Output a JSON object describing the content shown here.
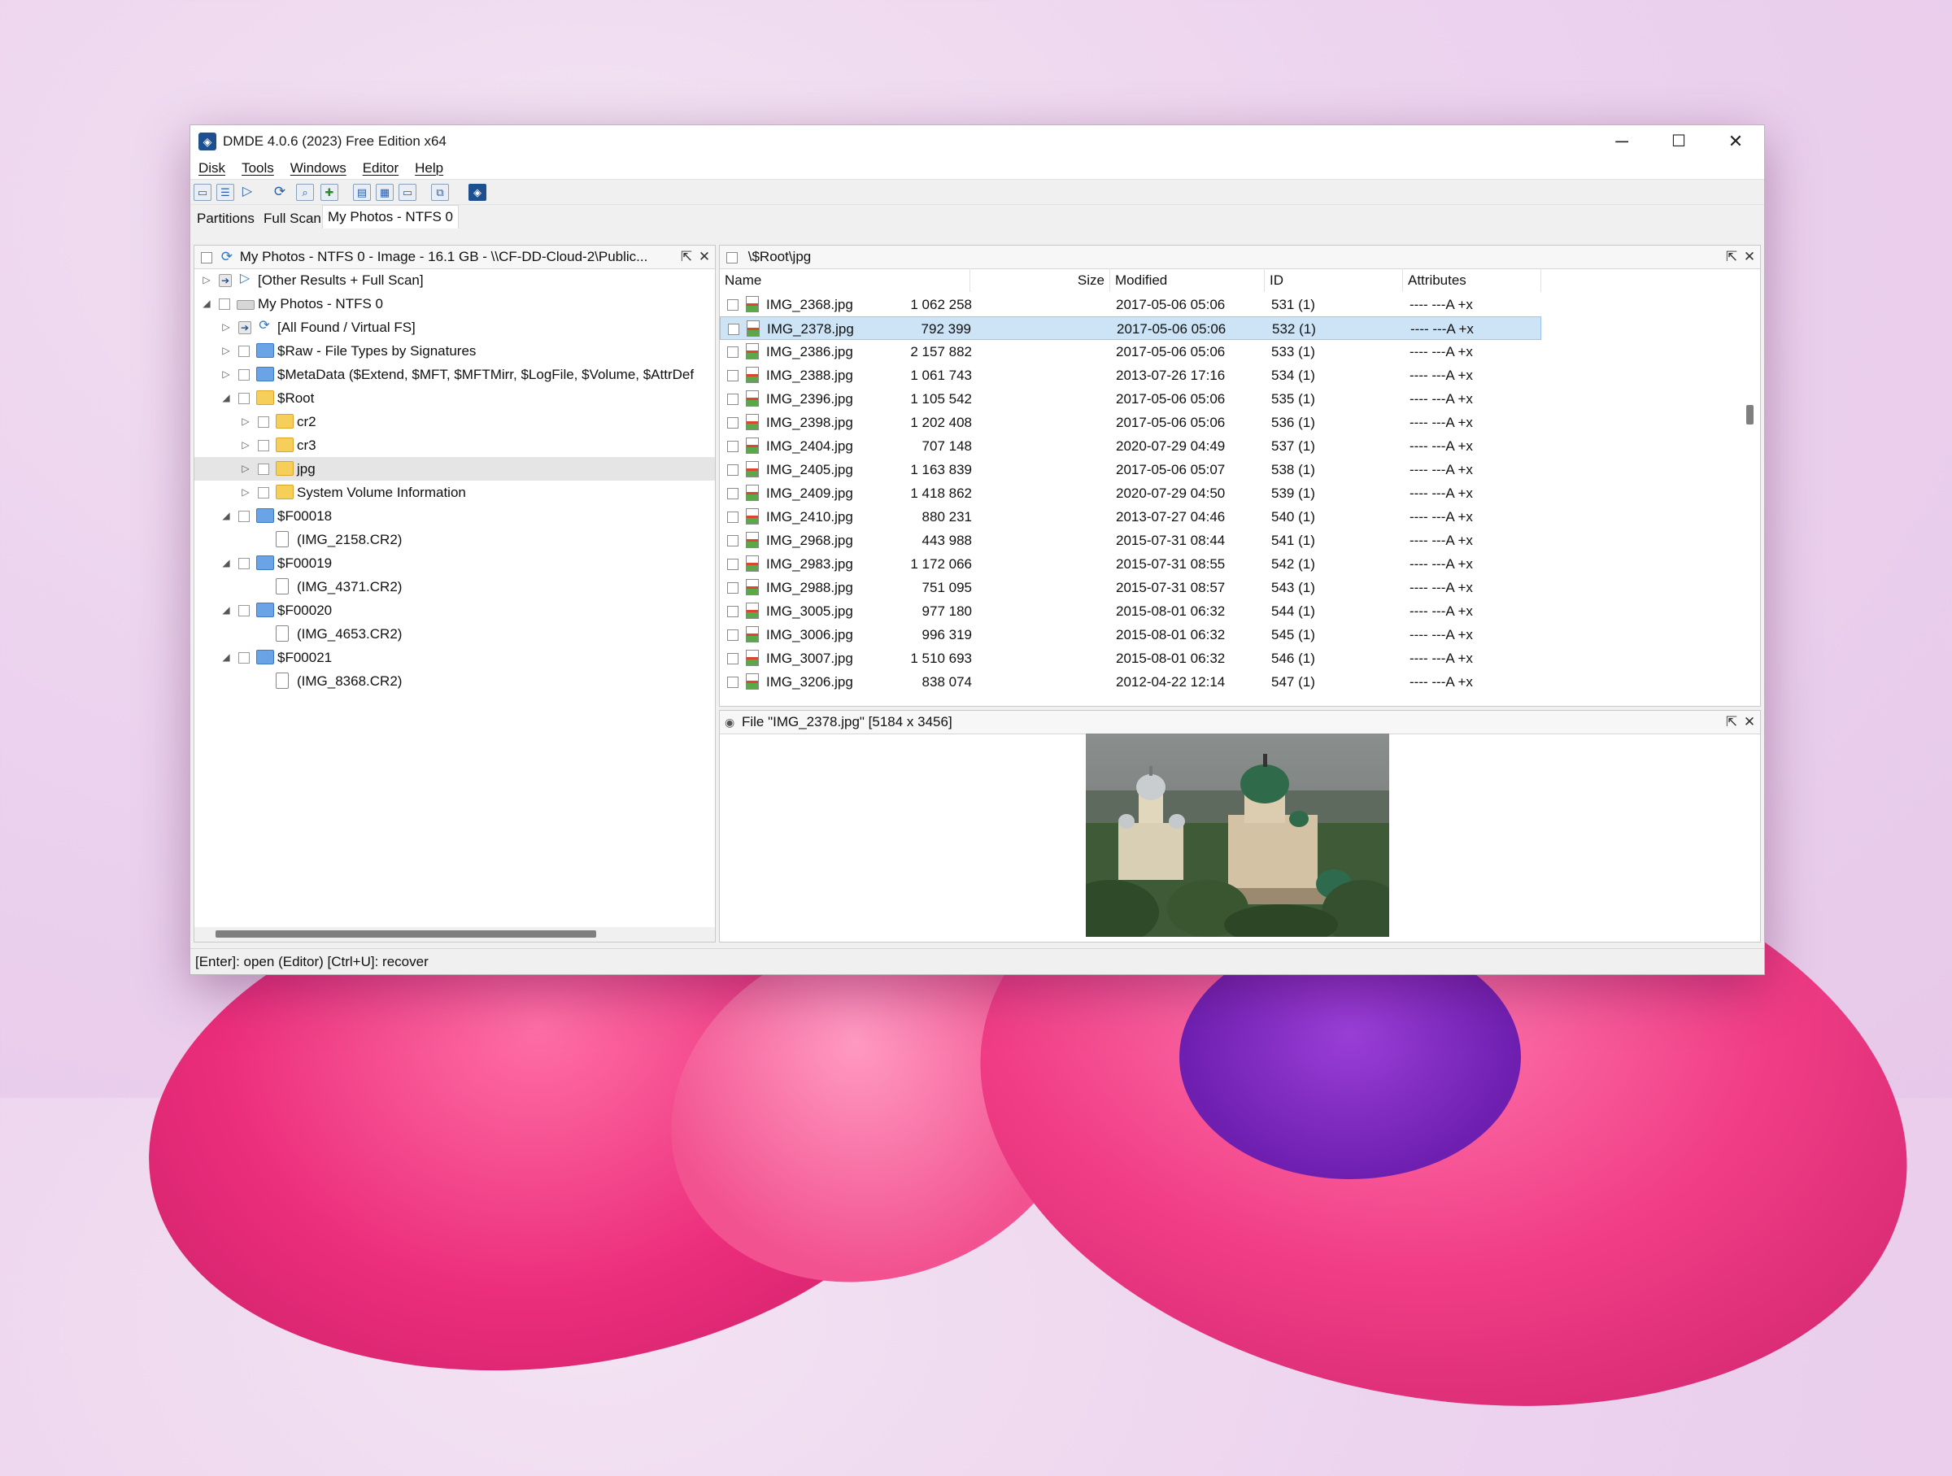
{
  "window": {
    "title": "DMDE 4.0.6 (2023) Free Edition x64",
    "controls": {
      "minimize": "─",
      "maximize": "☐",
      "close": "✕"
    }
  },
  "menu": [
    "Disk",
    "Tools",
    "Windows",
    "Editor",
    "Help"
  ],
  "tabs": [
    "Partitions",
    "Full Scan",
    "My Photos - NTFS 0"
  ],
  "tree_pane": {
    "header": "My Photos - NTFS 0 - Image - 16.1 GB - \\\\CF-DD-Cloud-2\\Public...",
    "items": [
      {
        "label": "[Other Results + Full Scan]"
      },
      {
        "label": "My Photos - NTFS 0"
      },
      {
        "label": "[All Found / Virtual FS]"
      },
      {
        "label": "$Raw - File Types by Signatures"
      },
      {
        "label": "$MetaData ($Extend, $MFT, $MFTMirr, $LogFile, $Volume, $AttrDef"
      },
      {
        "label": "$Root"
      },
      {
        "label": "cr2"
      },
      {
        "label": "cr3"
      },
      {
        "label": "jpg"
      },
      {
        "label": "System Volume Information"
      },
      {
        "label": "$F00018"
      },
      {
        "label": "(IMG_2158.CR2)"
      },
      {
        "label": "$F00019"
      },
      {
        "label": "(IMG_4371.CR2)"
      },
      {
        "label": "$F00020"
      },
      {
        "label": "(IMG_4653.CR2)"
      },
      {
        "label": "$F00021"
      },
      {
        "label": "(IMG_8368.CR2)"
      }
    ]
  },
  "file_pane": {
    "header": "\\$Root\\jpg",
    "columns": {
      "name": "Name",
      "size": "Size",
      "modified": "Modified",
      "id": "ID",
      "attributes": "Attributes"
    },
    "rows": [
      {
        "name": "IMG_2368.jpg",
        "size": "1 062 258",
        "modified": "2017-05-06 05:06",
        "id": "531 (1)",
        "attr": "---- ---A +x"
      },
      {
        "name": "IMG_2378.jpg",
        "size": "792 399",
        "modified": "2017-05-06 05:06",
        "id": "532 (1)",
        "attr": "---- ---A +x"
      },
      {
        "name": "IMG_2386.jpg",
        "size": "2 157 882",
        "modified": "2017-05-06 05:06",
        "id": "533 (1)",
        "attr": "---- ---A +x"
      },
      {
        "name": "IMG_2388.jpg",
        "size": "1 061 743",
        "modified": "2013-07-26 17:16",
        "id": "534 (1)",
        "attr": "---- ---A +x"
      },
      {
        "name": "IMG_2396.jpg",
        "size": "1 105 542",
        "modified": "2017-05-06 05:06",
        "id": "535 (1)",
        "attr": "---- ---A +x"
      },
      {
        "name": "IMG_2398.jpg",
        "size": "1 202 408",
        "modified": "2017-05-06 05:06",
        "id": "536 (1)",
        "attr": "---- ---A +x"
      },
      {
        "name": "IMG_2404.jpg",
        "size": "707 148",
        "modified": "2020-07-29 04:49",
        "id": "537 (1)",
        "attr": "---- ---A +x"
      },
      {
        "name": "IMG_2405.jpg",
        "size": "1 163 839",
        "modified": "2017-05-06 05:07",
        "id": "538 (1)",
        "attr": "---- ---A +x"
      },
      {
        "name": "IMG_2409.jpg",
        "size": "1 418 862",
        "modified": "2020-07-29 04:50",
        "id": "539 (1)",
        "attr": "---- ---A +x"
      },
      {
        "name": "IMG_2410.jpg",
        "size": "880 231",
        "modified": "2013-07-27 04:46",
        "id": "540 (1)",
        "attr": "---- ---A +x"
      },
      {
        "name": "IMG_2968.jpg",
        "size": "443 988",
        "modified": "2015-07-31 08:44",
        "id": "541 (1)",
        "attr": "---- ---A +x"
      },
      {
        "name": "IMG_2983.jpg",
        "size": "1 172 066",
        "modified": "2015-07-31 08:55",
        "id": "542 (1)",
        "attr": "---- ---A +x"
      },
      {
        "name": "IMG_2988.jpg",
        "size": "751 095",
        "modified": "2015-07-31 08:57",
        "id": "543 (1)",
        "attr": "---- ---A +x"
      },
      {
        "name": "IMG_3005.jpg",
        "size": "977 180",
        "modified": "2015-08-01 06:32",
        "id": "544 (1)",
        "attr": "---- ---A +x"
      },
      {
        "name": "IMG_3006.jpg",
        "size": "996 319",
        "modified": "2015-08-01 06:32",
        "id": "545 (1)",
        "attr": "---- ---A +x"
      },
      {
        "name": "IMG_3007.jpg",
        "size": "1 510 693",
        "modified": "2015-08-01 06:32",
        "id": "546 (1)",
        "attr": "---- ---A +x"
      },
      {
        "name": "IMG_3206.jpg",
        "size": "838 074",
        "modified": "2012-04-22 12:14",
        "id": "547 (1)",
        "attr": "---- ---A +x"
      }
    ]
  },
  "preview_pane": {
    "header": "File \"IMG_2378.jpg\" [5184 x 3456]"
  },
  "statusbar": "[Enter]: open (Editor)  [Ctrl+U]: recover",
  "colors": {
    "selection": "#cde4f7",
    "accent": "#1e4f8f"
  }
}
